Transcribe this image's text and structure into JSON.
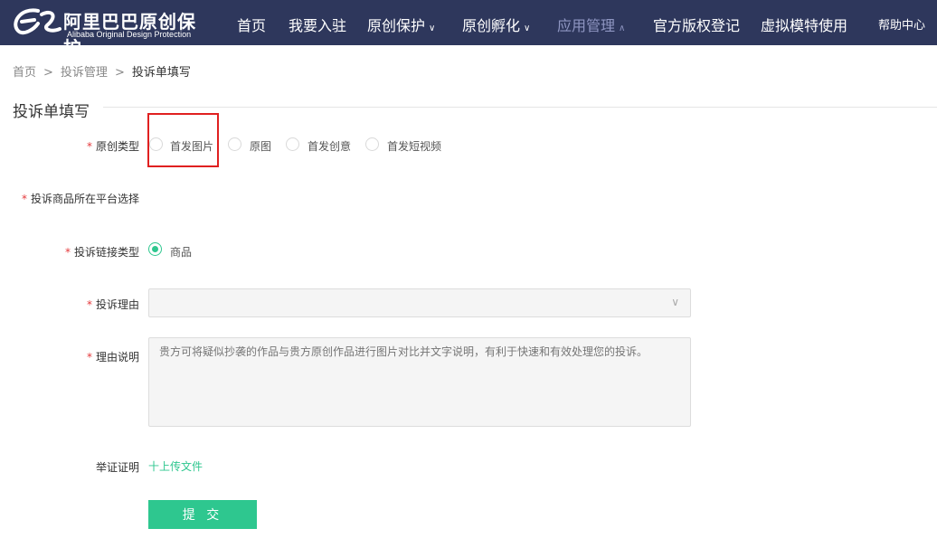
{
  "header": {
    "logo_cn": "阿里巴巴原创保护",
    "logo_en": "Alibaba Original Design Protection",
    "nav": [
      {
        "label": "首页"
      },
      {
        "label": "我要入驻"
      },
      {
        "label": "原创保护",
        "chevron": "∨"
      },
      {
        "label": "原创孵化",
        "chevron": "∨"
      },
      {
        "label": "应用管理",
        "chevron": "∧"
      },
      {
        "label": "官方版权登记"
      },
      {
        "label": "虚拟模特使用"
      }
    ],
    "help": "帮助中心"
  },
  "breadcrumb": {
    "items": [
      "首页",
      "投诉管理",
      "投诉单填写"
    ],
    "sep": ">"
  },
  "form": {
    "title": "投诉单填写",
    "required_mark": "*",
    "original_type": {
      "label": "原创类型",
      "options": [
        "首发图片",
        "原图",
        "首发创意",
        "首发短视频"
      ]
    },
    "platform": {
      "label": "投诉商品所在平台选择"
    },
    "link_type": {
      "label": "投诉链接类型",
      "options": [
        "商品"
      ],
      "selected": "商品"
    },
    "reason": {
      "label": "投诉理由",
      "value": "",
      "arrow": "∨"
    },
    "explanation": {
      "label": "理由说明",
      "placeholder": "贵方可将疑似抄袭的作品与贵方原创作品进行图片对比并文字说明，有利于快速和有效处理您的投诉。"
    },
    "evidence": {
      "label": "举证证明",
      "upload": "十上传文件"
    },
    "submit": "提 交"
  },
  "colors": {
    "nav_bg": "#2e375c",
    "accent": "#2ec78f",
    "required": "#e4393c"
  }
}
